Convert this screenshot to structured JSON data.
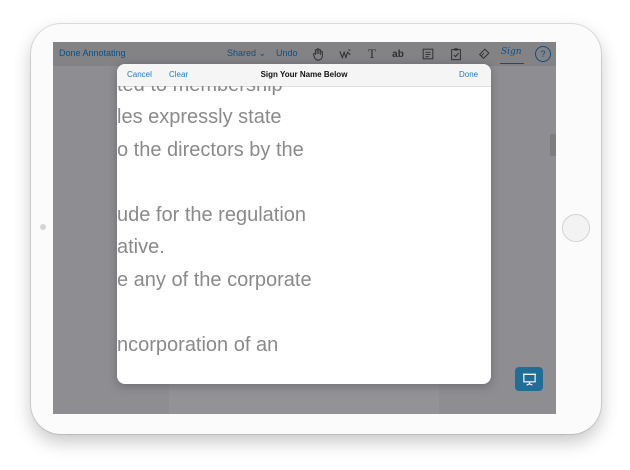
{
  "toolbar": {
    "done_annotating": "Done Annotating",
    "shared": "Shared",
    "undo": "Undo",
    "icons": [
      "hand-icon",
      "pen-icon",
      "text-icon",
      "ab-icon",
      "note-icon",
      "clipboard-check-icon",
      "eraser-icon",
      "signature-icon",
      "help-icon"
    ],
    "text_tool": "T",
    "ab_tool": "ab",
    "sign_label": "Sign",
    "help_label": "?"
  },
  "modal": {
    "cancel": "Cancel",
    "clear": "Clear",
    "title": "Sign Your Name Below",
    "done": "Done"
  },
  "document_lines": [
    "ted to membership",
    "les expressly state",
    "o the directors by the",
    "",
    "ude for the regulation",
    "ative.",
    "e any of the corporate",
    "",
    "ncorporation of an"
  ],
  "colors": {
    "accent_blue": "#1f7ad1",
    "toolbar_text": "#0c4f87",
    "present_button": "#1f6e98"
  }
}
